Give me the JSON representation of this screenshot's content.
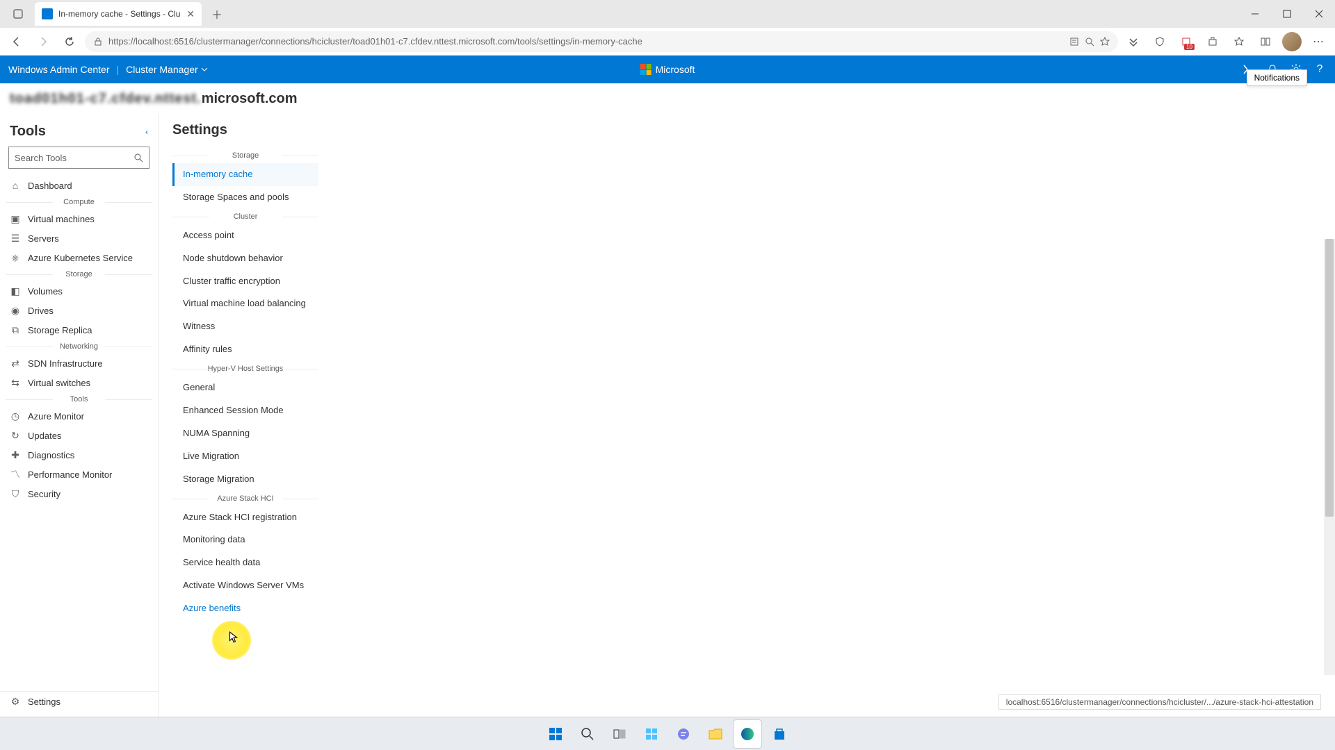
{
  "browser": {
    "tab_title": "In-memory cache - Settings - Clu",
    "url_display": "https://localhost:6516/clustermanager/connections/hcicluster/toad01h01-c7.cfdev.nttest.microsoft.com/tools/settings/in-memory-cache",
    "collections_badge": "10"
  },
  "wac": {
    "brand": "Windows Admin Center",
    "context": "Cluster Manager",
    "ms_label": "Microsoft",
    "breadcrumb_suffix": "microsoft.com",
    "breadcrumb_blur": "toad01h01-c7.cfdev.nttest."
  },
  "tooltip": {
    "notifications": "Notifications"
  },
  "tools": {
    "title": "Tools",
    "search_placeholder": "Search Tools",
    "groups": [
      {
        "label": "",
        "items": [
          {
            "icon": "home",
            "label": "Dashboard"
          }
        ]
      },
      {
        "label": "Compute",
        "items": [
          {
            "icon": "vm",
            "label": "Virtual machines"
          },
          {
            "icon": "server",
            "label": "Servers"
          },
          {
            "icon": "aks",
            "label": "Azure Kubernetes Service"
          }
        ]
      },
      {
        "label": "Storage",
        "items": [
          {
            "icon": "volume",
            "label": "Volumes"
          },
          {
            "icon": "drive",
            "label": "Drives"
          },
          {
            "icon": "replica",
            "label": "Storage Replica"
          }
        ]
      },
      {
        "label": "Networking",
        "items": [
          {
            "icon": "sdn",
            "label": "SDN Infrastructure"
          },
          {
            "icon": "vswitch",
            "label": "Virtual switches"
          }
        ]
      },
      {
        "label": "Tools",
        "items": [
          {
            "icon": "monitor",
            "label": "Azure Monitor"
          },
          {
            "icon": "updates",
            "label": "Updates"
          },
          {
            "icon": "diag",
            "label": "Diagnostics"
          },
          {
            "icon": "perf",
            "label": "Performance Monitor"
          },
          {
            "icon": "security",
            "label": "Security"
          }
        ]
      }
    ],
    "footer": {
      "icon": "gear",
      "label": "Settings"
    }
  },
  "settings": {
    "title": "Settings",
    "groups": [
      {
        "label": "Storage",
        "items": [
          {
            "label": "In-memory cache",
            "active": true
          },
          {
            "label": "Storage Spaces and pools"
          }
        ]
      },
      {
        "label": "Cluster",
        "items": [
          {
            "label": "Access point"
          },
          {
            "label": "Node shutdown behavior"
          },
          {
            "label": "Cluster traffic encryption"
          },
          {
            "label": "Virtual machine load balancing"
          },
          {
            "label": "Witness"
          },
          {
            "label": "Affinity rules"
          }
        ]
      },
      {
        "label": "Hyper-V Host Settings",
        "items": [
          {
            "label": "General"
          },
          {
            "label": "Enhanced Session Mode"
          },
          {
            "label": "NUMA Spanning"
          },
          {
            "label": "Live Migration"
          },
          {
            "label": "Storage Migration"
          }
        ]
      },
      {
        "label": "Azure Stack HCI",
        "items": [
          {
            "label": "Azure Stack HCI registration"
          },
          {
            "label": "Monitoring data"
          },
          {
            "label": "Service health data"
          },
          {
            "label": "Activate Windows Server VMs"
          },
          {
            "label": "Azure benefits",
            "hover": true
          }
        ]
      }
    ]
  },
  "status_url": "localhost:6516/clustermanager/connections/hcicluster/.../azure-stack-hci-attestation"
}
